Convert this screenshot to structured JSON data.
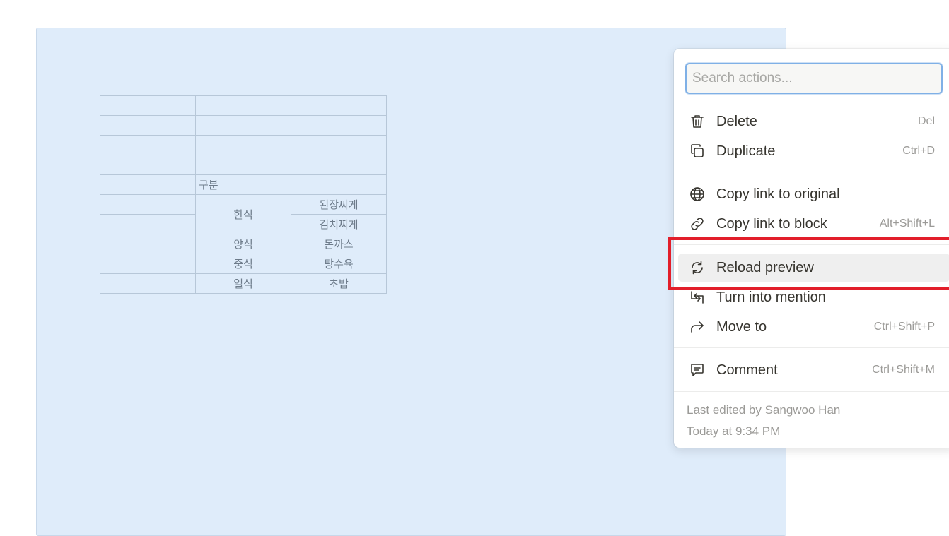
{
  "table": {
    "rows": [
      [
        "",
        "",
        ""
      ],
      [
        "",
        "",
        ""
      ],
      [
        "",
        "",
        ""
      ],
      [
        "",
        "",
        ""
      ],
      [
        "",
        "구분",
        ""
      ],
      [
        "",
        "한식",
        "된장찌게"
      ],
      [
        "",
        "",
        "김치찌게"
      ],
      [
        "",
        "양식",
        "돈까스"
      ],
      [
        "",
        "중식",
        "탕수육"
      ],
      [
        "",
        "일식",
        "초밥"
      ]
    ]
  },
  "menu": {
    "search_placeholder": "Search actions...",
    "items": [
      {
        "label": "Delete",
        "shortcut": "Del",
        "icon": "trash-icon"
      },
      {
        "label": "Duplicate",
        "shortcut": "Ctrl+D",
        "icon": "duplicate-icon"
      },
      {
        "label": "Copy link to original",
        "shortcut": "",
        "icon": "globe-icon"
      },
      {
        "label": "Copy link to block",
        "shortcut": "Alt+Shift+L",
        "icon": "link-icon"
      },
      {
        "label": "Reload preview",
        "shortcut": "",
        "icon": "reload-icon"
      },
      {
        "label": "Turn into mention",
        "shortcut": "",
        "icon": "turn-into-icon"
      },
      {
        "label": "Move to",
        "shortcut": "Ctrl+Shift+P",
        "icon": "move-arrow-icon"
      },
      {
        "label": "Comment",
        "shortcut": "Ctrl+Shift+M",
        "icon": "comment-icon"
      }
    ],
    "footer": {
      "edited_by": "Last edited by Sangwoo Han",
      "edited_time": "Today at 9:34 PM"
    }
  },
  "colors": {
    "highlight": "#e21e2a",
    "preview_bg": "#dfecfa"
  }
}
